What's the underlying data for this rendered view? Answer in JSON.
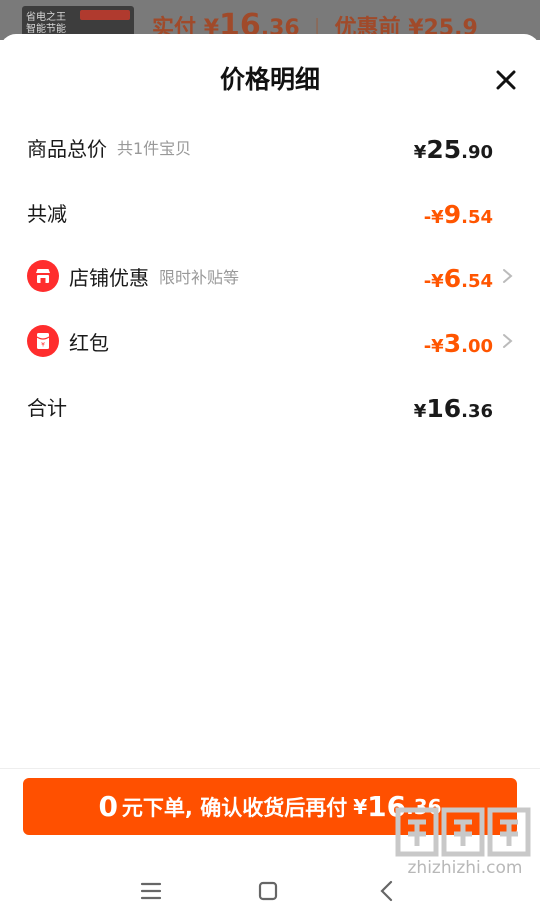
{
  "background": {
    "thumb_label": "省电之王 智能节能",
    "price_prefix": "实付",
    "price_symbol": "¥",
    "price_int": "16",
    "price_dec": ".36",
    "separator": "|",
    "original_label": "优惠前",
    "original_price": "¥25.9"
  },
  "sheet": {
    "title": "价格明细",
    "close_icon": "close-icon"
  },
  "rows": {
    "total": {
      "label": "商品总价",
      "sub": "共1件宝贝",
      "symbol": "¥",
      "int": "25",
      "dec": ".90"
    },
    "reduced": {
      "label": "共减",
      "symbol": "-¥",
      "int": "9",
      "dec": ".54"
    },
    "store": {
      "label": "店铺优惠",
      "sub": "限时补贴等",
      "symbol": "-¥",
      "int": "6",
      "dec": ".54",
      "icon": "store-icon"
    },
    "redpacket": {
      "label": "红包",
      "symbol": "-¥",
      "int": "3",
      "dec": ".00",
      "icon": "red-packet-icon"
    },
    "sum": {
      "label": "合计",
      "symbol": "¥",
      "int": "16",
      "dec": ".36"
    }
  },
  "pay_button": {
    "zero": "0",
    "text": "元下单, 确认收货后再付",
    "symbol": "¥",
    "int": "16",
    "dec": ".36"
  },
  "nav": {
    "menu_icon": "menu-icon",
    "home_icon": "home-icon",
    "back_icon": "back-icon"
  },
  "watermark": {
    "text": "zhizhizhi.com"
  },
  "colors": {
    "accent": "#ff5000",
    "discount": "#ff5500",
    "icon_red": "#ff2d2d"
  }
}
